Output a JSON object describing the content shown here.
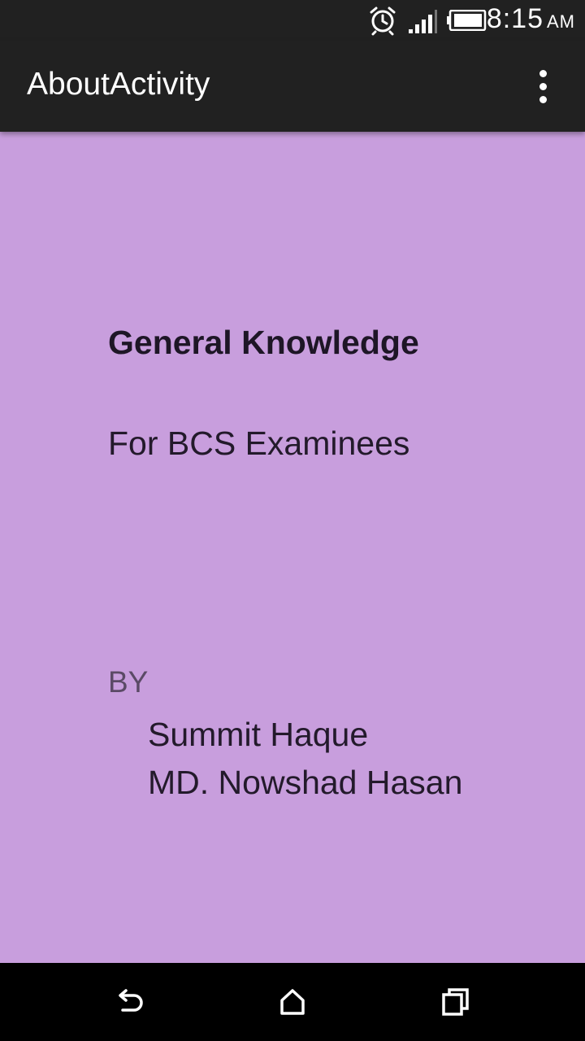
{
  "status_bar": {
    "time": "8:15",
    "ampm": "AM",
    "icons": [
      "alarm-icon",
      "signal-icon",
      "battery-icon"
    ]
  },
  "app_bar": {
    "title": "AboutActivity",
    "overflow_icon": "more-vert-icon"
  },
  "content": {
    "app_name": "General Knowledge",
    "subtitle": "For BCS Examinees",
    "by_label": "BY",
    "authors": [
      "Summit Haque",
      "MD. Nowshad Hasan"
    ]
  },
  "nav_bar": {
    "icons": [
      "back-icon",
      "home-icon",
      "recents-icon"
    ]
  },
  "colors": {
    "background": "#c89edd",
    "app_bar": "#212121",
    "nav_bar": "#000000"
  }
}
